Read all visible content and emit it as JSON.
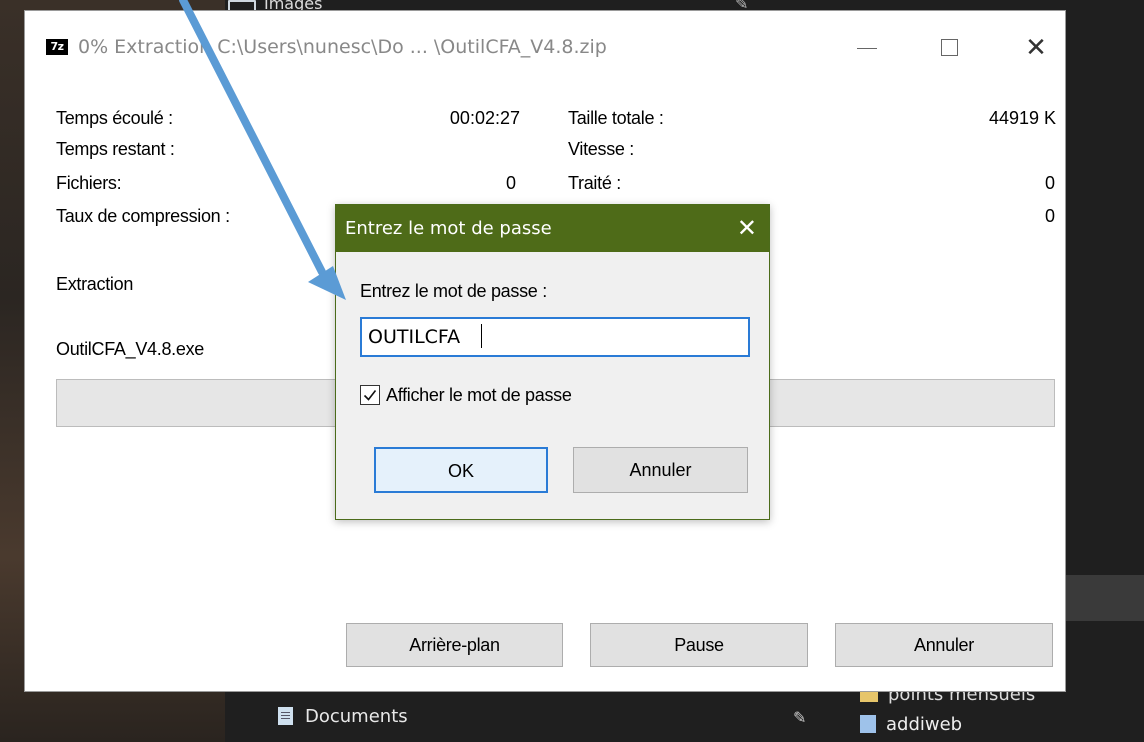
{
  "background": {
    "top_item_label": "Images",
    "documents_label": "Documents",
    "points_label": "points mensuels",
    "addiweb_label": "addiweb"
  },
  "window": {
    "app_icon_text": "7z",
    "title": "0% Extraction C:\\Users\\nunesc\\Do ... \\OutilCFA_V4.8.zip",
    "stats": {
      "elapsed_label": "Temps écoulé :",
      "elapsed_value": "00:02:27",
      "remaining_label": "Temps restant :",
      "files_label": "Fichiers:",
      "files_value": "0",
      "ratio_label": "Taux de compression :",
      "total_size_label": "Taille totale :",
      "total_size_value": "44919 K",
      "speed_label": "Vitesse :",
      "processed_label": "Traité :",
      "processed_value": "0",
      "row4_right_value": "0"
    },
    "operation_label": "Extraction",
    "current_file": "OutilCFA_V4.8.exe",
    "progress_percent": 0,
    "buttons": {
      "background": "Arrière-plan",
      "pause": "Pause",
      "cancel": "Annuler"
    }
  },
  "password_dialog": {
    "title": "Entrez le mot de passe",
    "close_glyph": "✕",
    "prompt": "Entrez le mot de passe :",
    "password_value": "OUTILCFA",
    "show_password_label": "Afficher le mot de passe",
    "show_password_checked": true,
    "ok_label": "OK",
    "cancel_label": "Annuler"
  },
  "colors": {
    "dialog_title_bg": "#4e6b18",
    "focus_blue": "#2a7bd6",
    "arrow_blue": "#5b9bd5"
  }
}
